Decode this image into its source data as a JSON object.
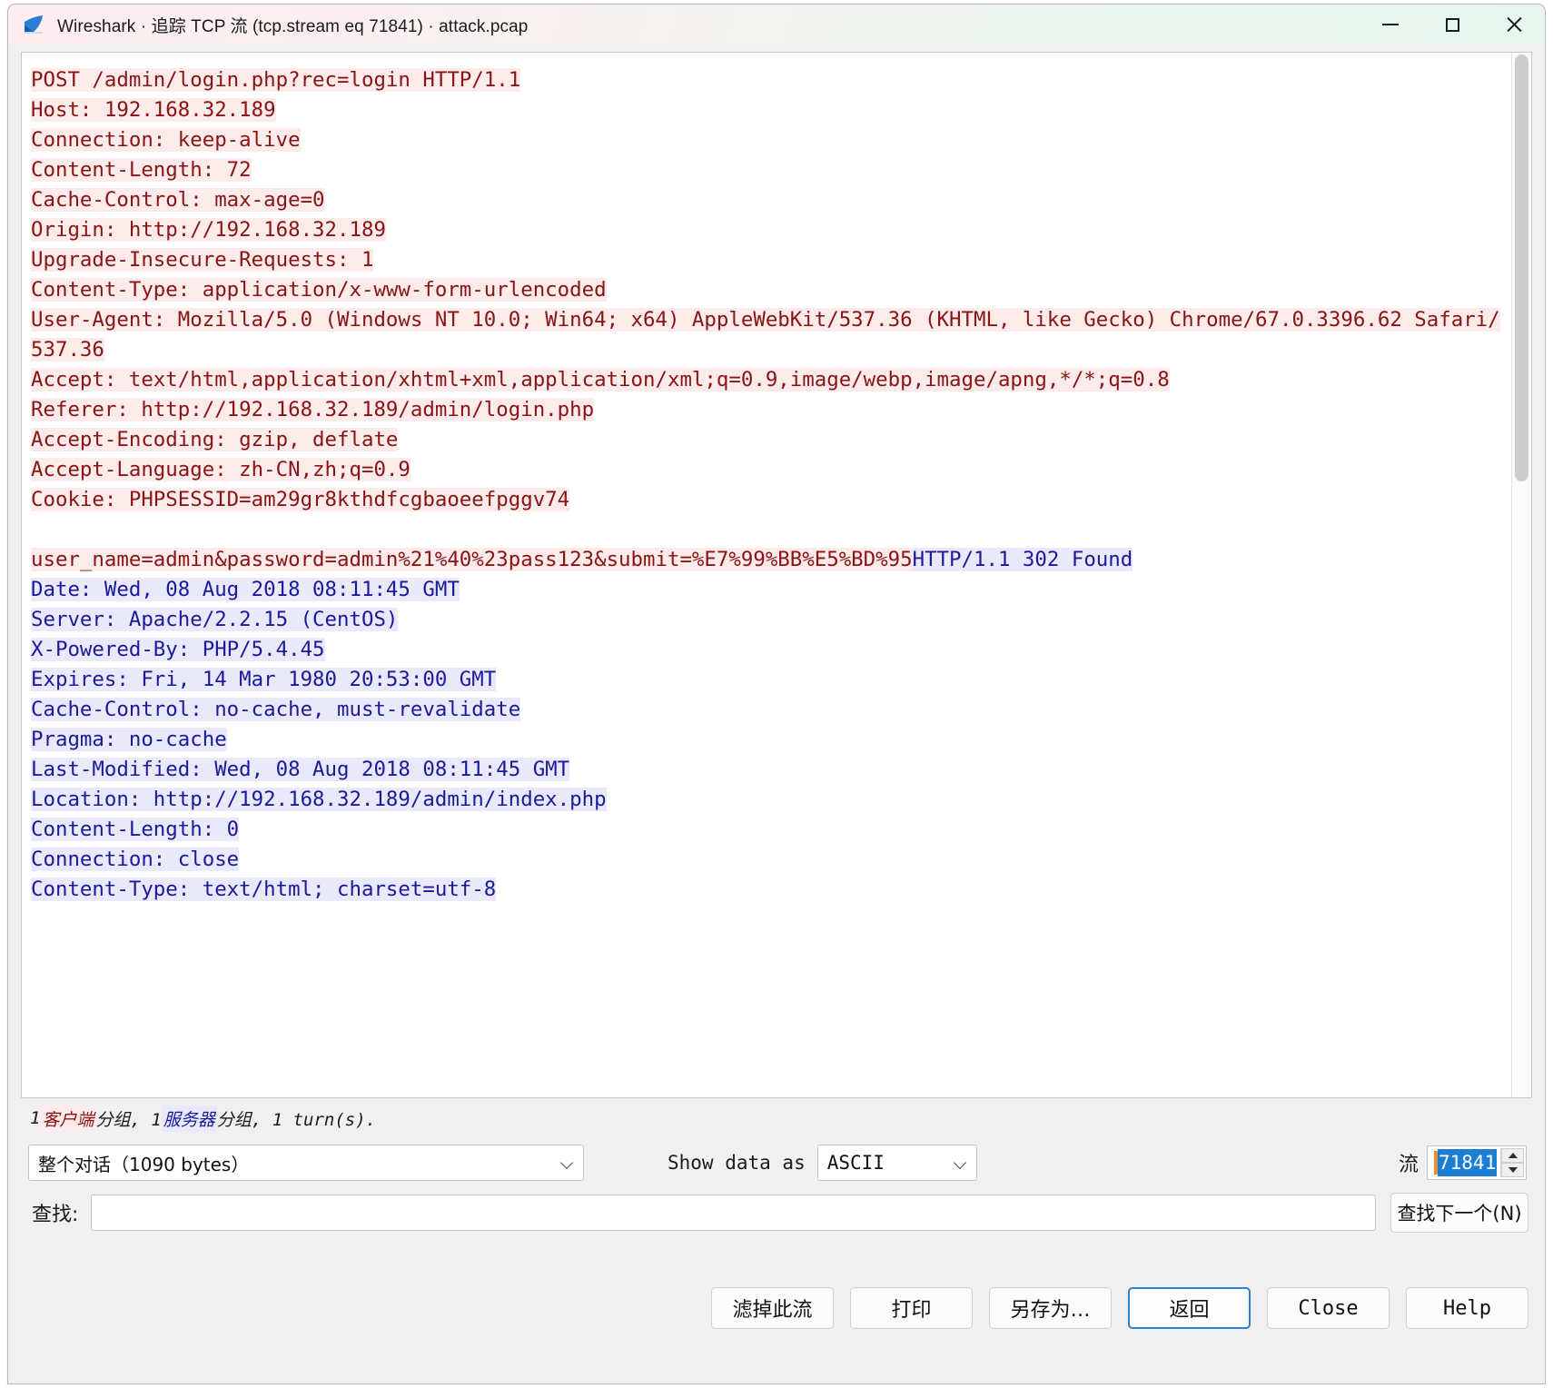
{
  "window": {
    "title": "Wireshark · 追踪 TCP 流 (tcp.stream eq 71841) · attack.pcap",
    "icon": "wireshark-fin-icon",
    "controls": {
      "minimize": "minimize-icon",
      "maximize": "maximize-icon",
      "close": "close-icon"
    }
  },
  "stream": {
    "client_color": "#8a1414",
    "client_bg": "#fbebeb",
    "server_color": "#1a1a9c",
    "server_bg": "#e9e9fa",
    "blocks": [
      {
        "role": "client",
        "text": "POST /admin/login.php?rec=login HTTP/1.1\nHost: 192.168.32.189\nConnection: keep-alive\nContent-Length: 72\nCache-Control: max-age=0\nOrigin: http://192.168.32.189\nUpgrade-Insecure-Requests: 1\nContent-Type: application/x-www-form-urlencoded\nUser-Agent: Mozilla/5.0 (Windows NT 10.0; Win64; x64) AppleWebKit/537.36 (KHTML, like Gecko) Chrome/67.0.3396.62 Safari/537.36\nAccept: text/html,application/xhtml+xml,application/xml;q=0.9,image/webp,image/apng,*/*;q=0.8\nReferer: http://192.168.32.189/admin/login.php\nAccept-Encoding: gzip, deflate\nAccept-Language: zh-CN,zh;q=0.9\nCookie: PHPSESSID=am29gr8kthdfcgbaoeefpggv74"
      },
      {
        "role": "blank",
        "text": ""
      },
      {
        "role": "client",
        "text": "user_name=admin&password=admin%21%40%23pass123&submit=%E7%99%BB%E5%BD%95"
      },
      {
        "role": "server",
        "text": "HTTP/1.1 302 Found\nDate: Wed, 08 Aug 2018 08:11:45 GMT\nServer: Apache/2.2.15 (CentOS)\nX-Powered-By: PHP/5.4.45\nExpires: Fri, 14 Mar 1980 20:53:00 GMT\nCache-Control: no-cache, must-revalidate\nPragma: no-cache\nLast-Modified: Wed, 08 Aug 2018 08:11:45 GMT\nLocation: http://192.168.32.189/admin/index.php\nContent-Length: 0\nConnection: close\nContent-Type: text/html; charset=utf-8"
      }
    ]
  },
  "status": {
    "prefix": "1 ",
    "client_word": "客户端",
    "mid1": " 分组, 1 ",
    "server_word": "服务器",
    "mid2": " 分组, 1 turn(s)."
  },
  "controls": {
    "conversation_select": "整个对话（1090 bytes）",
    "show_data_as_label": "Show data as",
    "show_data_as_value": "ASCII",
    "stream_label": "流",
    "stream_value": "71841",
    "spin_up_icon": "chevron-up-icon",
    "spin_down_icon": "chevron-down-icon"
  },
  "find": {
    "label": "查找:",
    "value": "",
    "placeholder": "",
    "find_next_button": "查找下一个(N)"
  },
  "buttons": [
    {
      "label": "滤掉此流",
      "name": "filter-out-this-stream-button",
      "mono": false,
      "default": false
    },
    {
      "label": "打印",
      "name": "print-button",
      "mono": false,
      "default": false
    },
    {
      "label": "另存为…",
      "name": "save-as-button",
      "mono": false,
      "default": false
    },
    {
      "label": "返回",
      "name": "back-button",
      "mono": false,
      "default": true
    },
    {
      "label": "Close",
      "name": "close-button",
      "mono": true,
      "default": false
    },
    {
      "label": "Help",
      "name": "help-button",
      "mono": true,
      "default": false
    }
  ]
}
